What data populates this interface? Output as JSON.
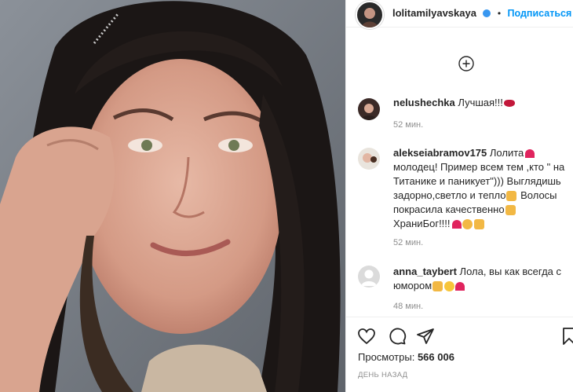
{
  "post": {
    "author": "lolitamilyavskaya",
    "follow_label": "Подписаться",
    "separator": "•"
  },
  "comments": [
    {
      "username": "nelushechka",
      "text": "Лучшая!!!",
      "emoji": [
        "lips"
      ],
      "time": "52 мин."
    },
    {
      "username": "alekseiabramov175",
      "lines": [
        "Лолита",
        "молодец! Пример всем тем ,кто \" на",
        "Титанике и паникует\"))) Выглядишь",
        "задорно,светло и тепло",
        "Волосы",
        "покрасила качественно",
        "ХраниБог!!!!"
      ],
      "time": "52 мин."
    },
    {
      "username": "anna_taybert",
      "lines": [
        "Лола, вы как всегда с",
        "юмором"
      ],
      "time": "48 мин."
    }
  ],
  "stats": {
    "views_label": "Просмотры:",
    "views_value": "566 006",
    "posted": "ДЕНЬ НАЗАД"
  },
  "icons": [
    "add-comment-icon",
    "heart-icon",
    "comment-icon",
    "share-icon",
    "bookmark-icon",
    "verified-badge-icon"
  ],
  "colors": {
    "accent": "#0095f6",
    "text": "#262626",
    "muted": "#8e8e8e",
    "heart": "#e0245e"
  }
}
